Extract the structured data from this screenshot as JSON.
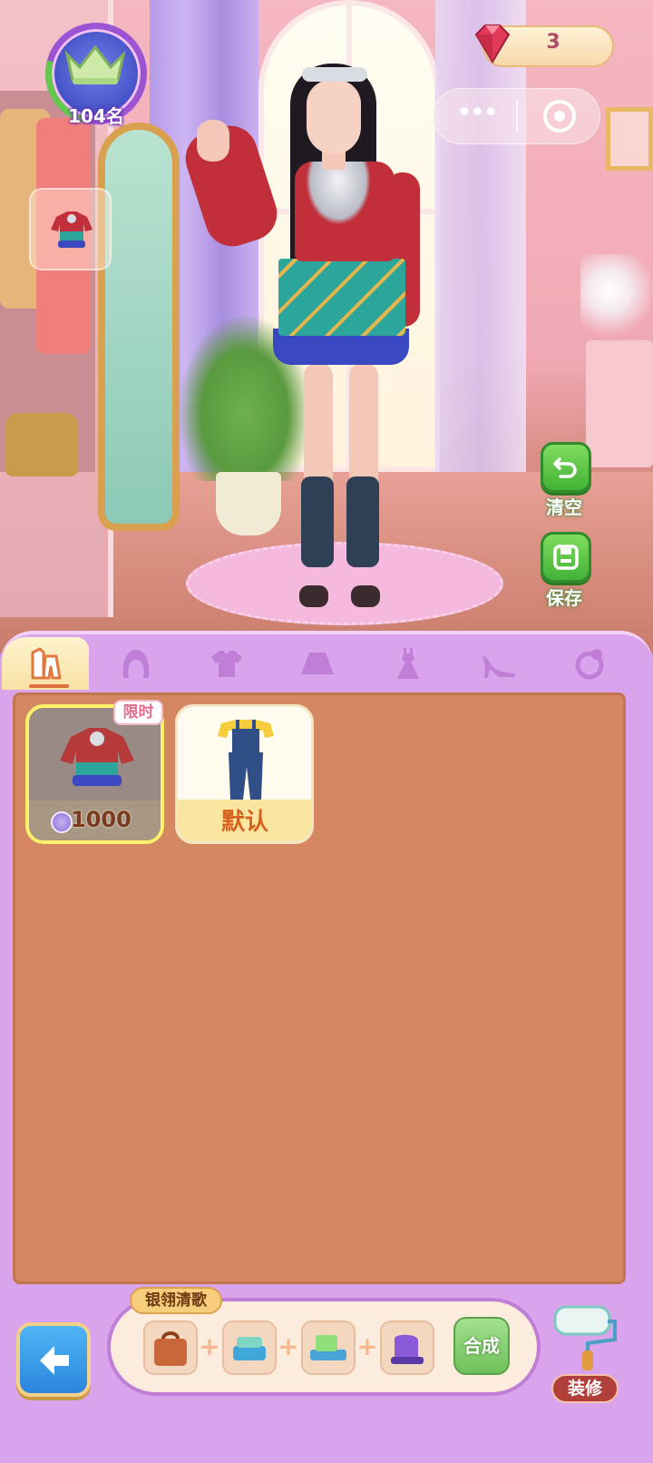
{
  "hud": {
    "rank_label": "104名",
    "gems": "3"
  },
  "side_buttons": {
    "clear_label": "清空",
    "save_label": "保存"
  },
  "tabs": [
    {
      "name": "outfit",
      "icon": "outfit-icon",
      "active": true
    },
    {
      "name": "hair",
      "icon": "hair-icon",
      "active": false
    },
    {
      "name": "top",
      "icon": "shirt-icon",
      "active": false
    },
    {
      "name": "skirt",
      "icon": "skirt-icon",
      "active": false
    },
    {
      "name": "dress",
      "icon": "dress-icon",
      "active": false
    },
    {
      "name": "shoes",
      "icon": "high-heel-icon",
      "active": false
    },
    {
      "name": "accessory",
      "icon": "accessory-icon",
      "active": false
    }
  ],
  "items": [
    {
      "badge": "限时",
      "price": "1000",
      "currency_icon": "coin-icon",
      "selected": true
    },
    {
      "label": "默认"
    }
  ],
  "recipe": {
    "title": "银翎清歌",
    "ingredients": [
      "bag-icon",
      "fabric-icon",
      "sewing-machine-icon",
      "purple-machine-icon"
    ],
    "craft_label": "合成"
  },
  "decor": {
    "label": "装修"
  },
  "colors": {
    "panel": "#d9a4ec",
    "grid_bg": "#d48761",
    "accent_green": "#43b237",
    "back_blue": "#2b86dc"
  }
}
